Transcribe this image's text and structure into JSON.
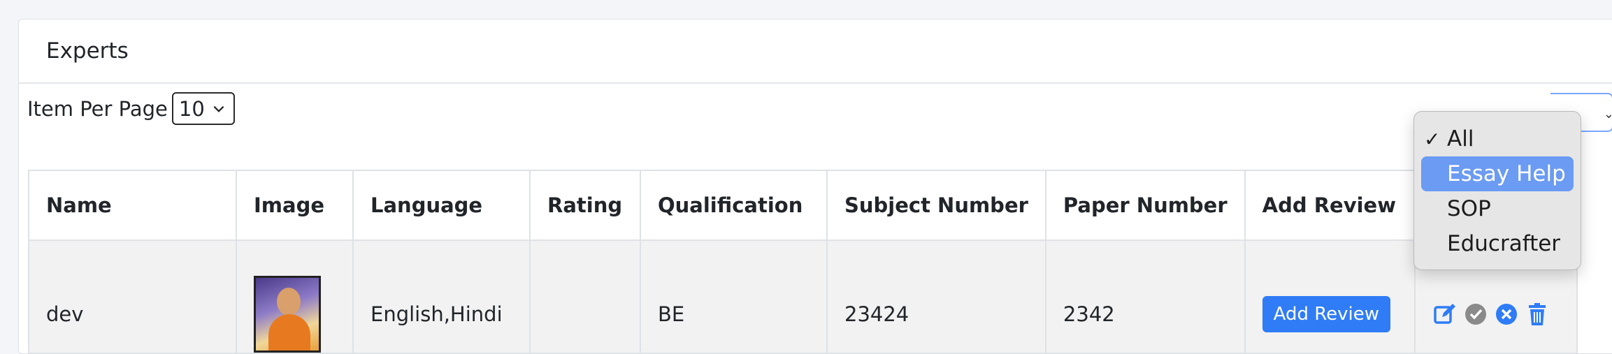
{
  "card": {
    "title": "Experts"
  },
  "toolbar": {
    "per_page_label": "Item Per Page",
    "per_page_value": "10"
  },
  "table": {
    "headers": [
      "Name",
      "Image",
      "Language",
      "Rating",
      "Qualification",
      "Subject Number",
      "Paper Number",
      "Add Review",
      ""
    ],
    "rows": [
      {
        "name": "dev",
        "language": "English,Hindi",
        "rating": "",
        "qualification": "BE",
        "subject_number": "23424",
        "paper_number": "2342",
        "add_review_label": "Add Review"
      }
    ]
  },
  "filter_dropdown": {
    "selected": "All",
    "hovered": "Essay Help",
    "options": [
      "All",
      "Essay Help",
      "SOP",
      "Educrafter"
    ],
    "check_glyph": "✓"
  },
  "icons": {
    "edit": "edit-icon",
    "approve": "check-circle-icon",
    "reject": "x-circle-icon",
    "delete": "trash-icon"
  },
  "colors": {
    "primary": "#2f7cf6",
    "dropdown_highlight": "#6b9bf2",
    "approve_gray": "#8a8a8a"
  }
}
